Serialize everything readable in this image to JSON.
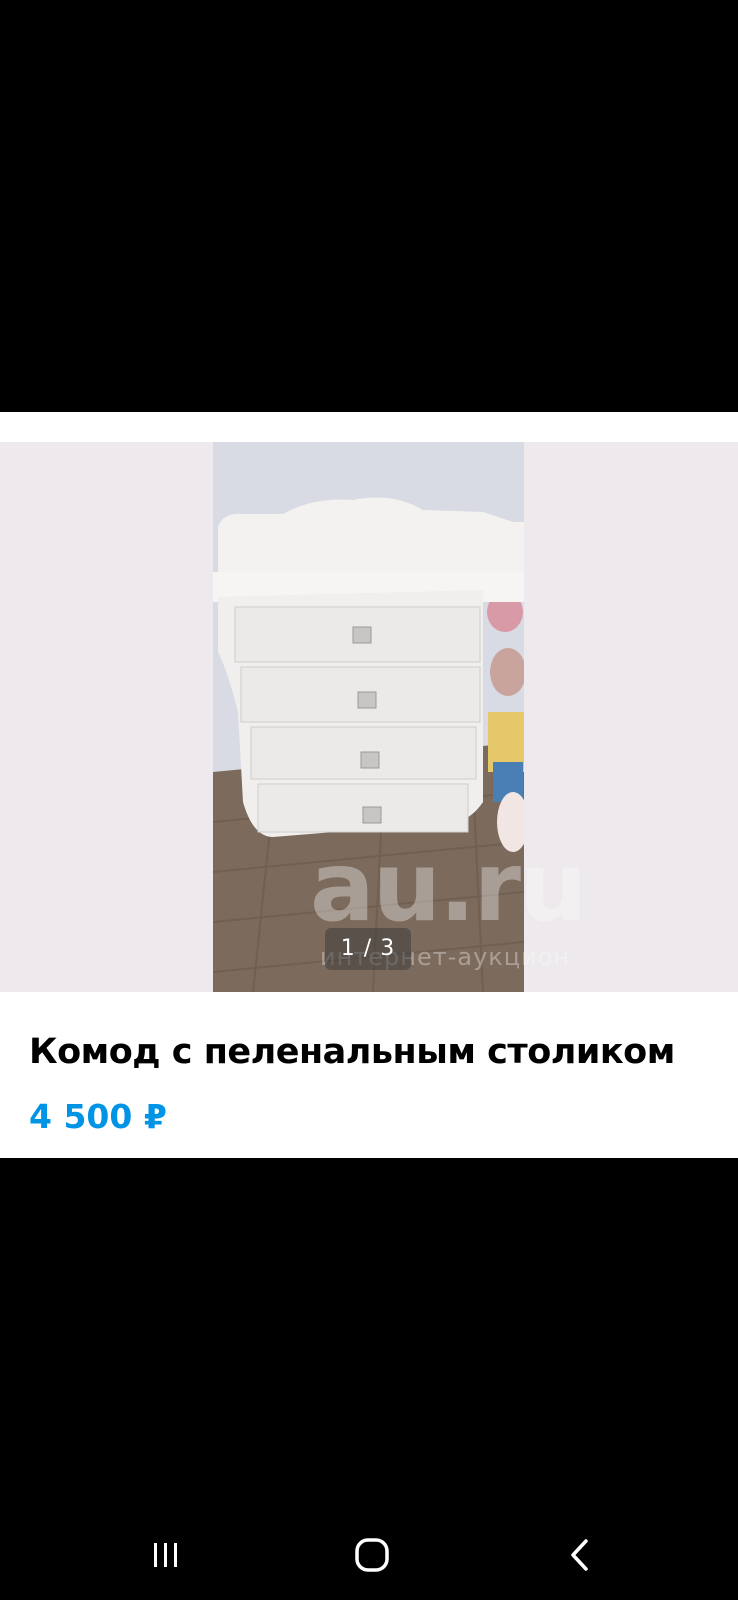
{
  "listing": {
    "title": "Комод с пеленальным столиком",
    "price": "4 500 ₽",
    "image_counter": "1 / 3",
    "watermark": {
      "brand": "au.ru",
      "tagline": "интернет-аукцион"
    },
    "photo_subject": "white chest of drawers with changing table"
  },
  "colors": {
    "price": "#0094e6",
    "page_background": "#000000",
    "card_background": "#ffffff",
    "gallery_background": "#ede9ec"
  },
  "navbar": {
    "recents_icon": "recents-icon",
    "home_icon": "home-icon",
    "back_icon": "back-icon"
  }
}
